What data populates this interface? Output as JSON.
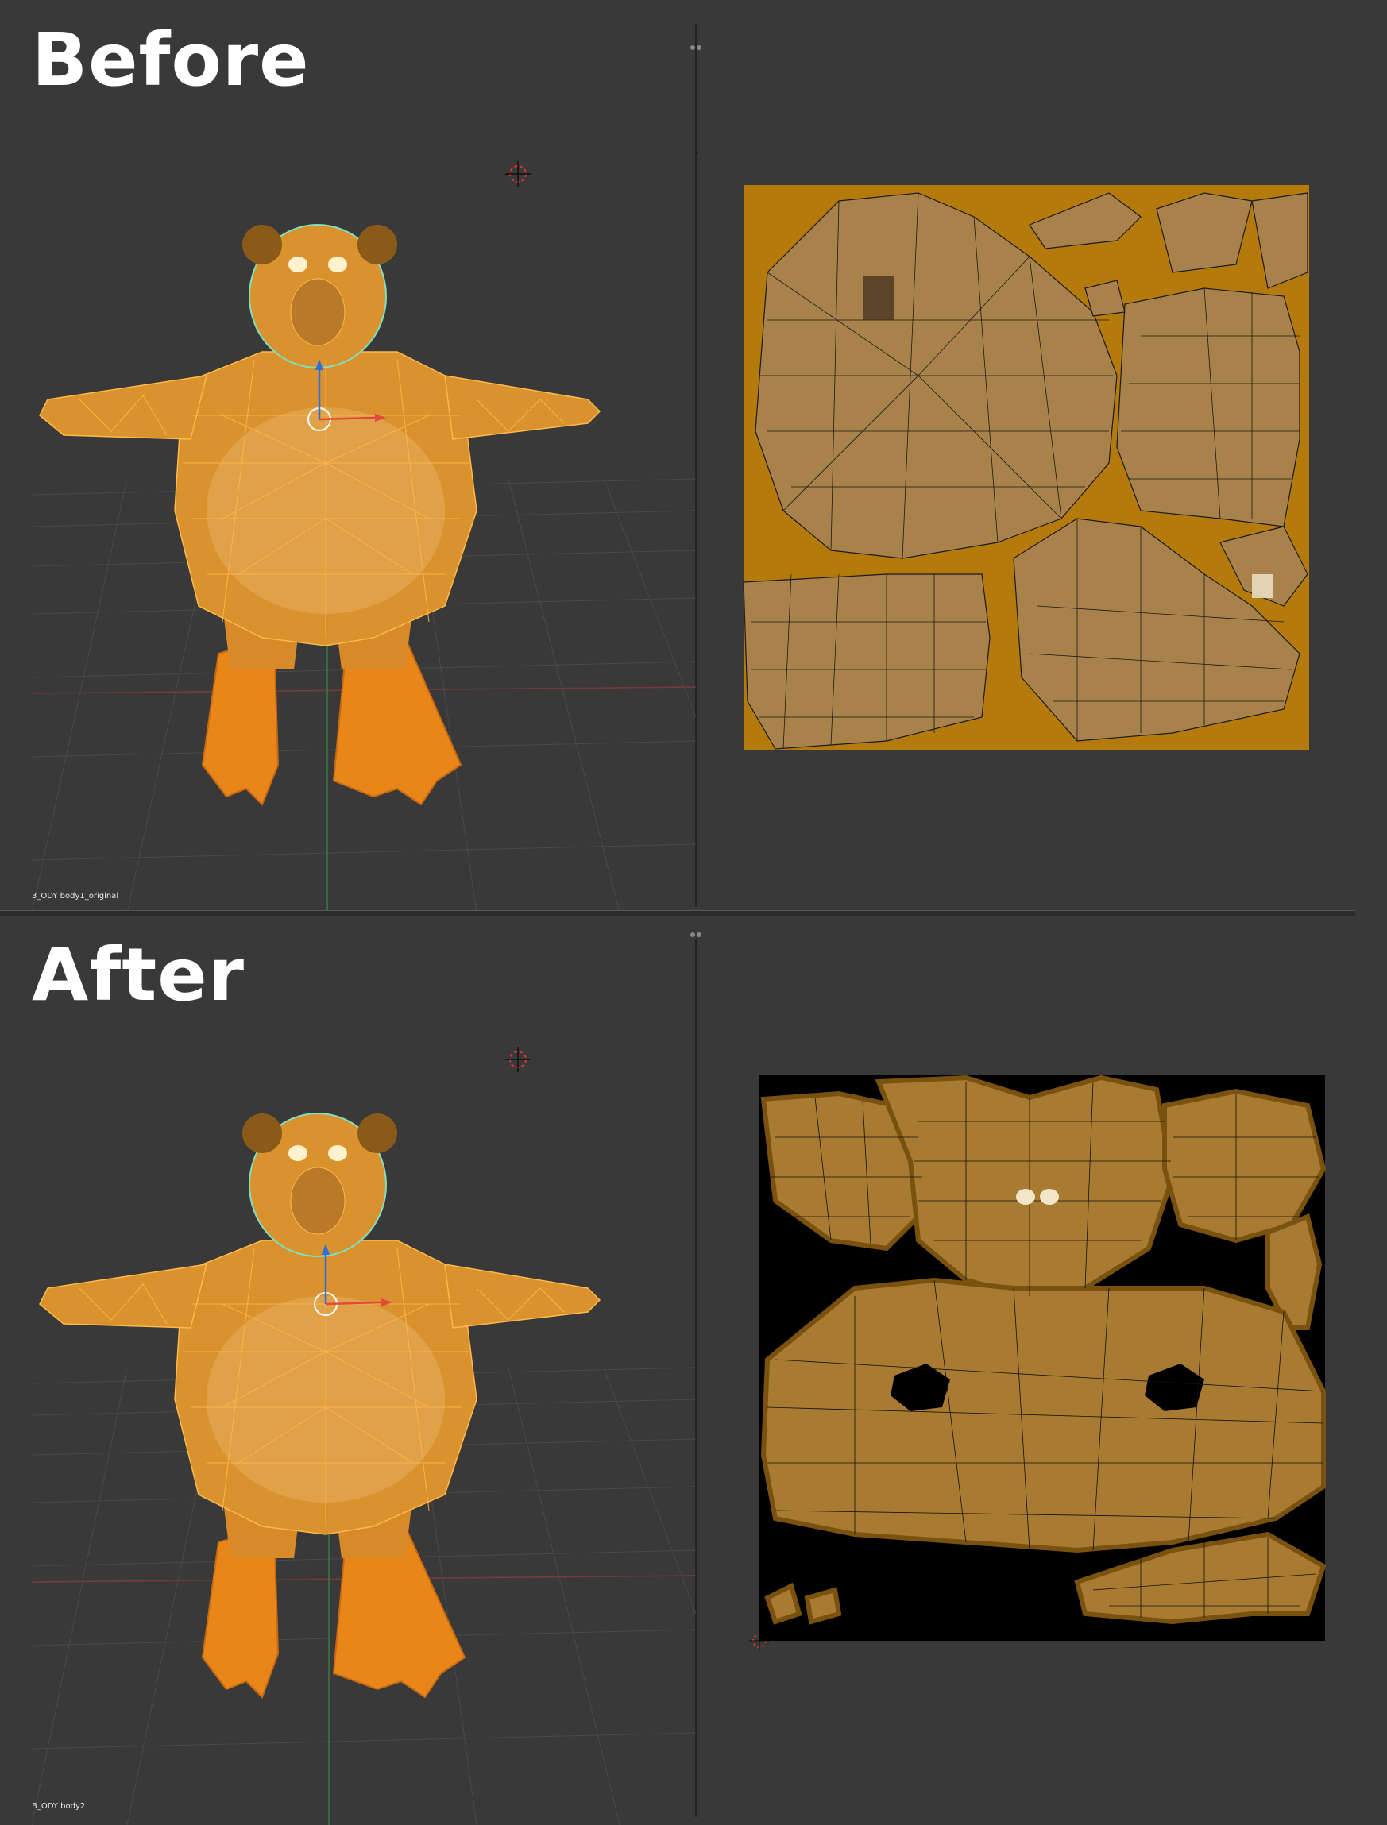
{
  "panels": [
    {
      "title": "Before",
      "object_label": "3_ODY body1_original",
      "uv_background": "#b57a0c"
    },
    {
      "title": "After",
      "object_label": "B_ODY body2",
      "uv_background": "#000000"
    }
  ],
  "colors": {
    "editor_bg": "#393939",
    "mesh_orange": "#e38a1e",
    "wire_orange": "#ffb84a",
    "wire_seam": "#7fe0c0",
    "uv_fill": "#a87a32",
    "uv_wire": "#1a1a1a",
    "axis_x": "#e04a3a",
    "axis_y": "#3ba050",
    "axis_z": "#2f6ee0"
  },
  "icons": [
    "3d-cursor-icon",
    "object-origin-icon",
    "uv-cursor-icon",
    "split-handle-icon"
  ]
}
